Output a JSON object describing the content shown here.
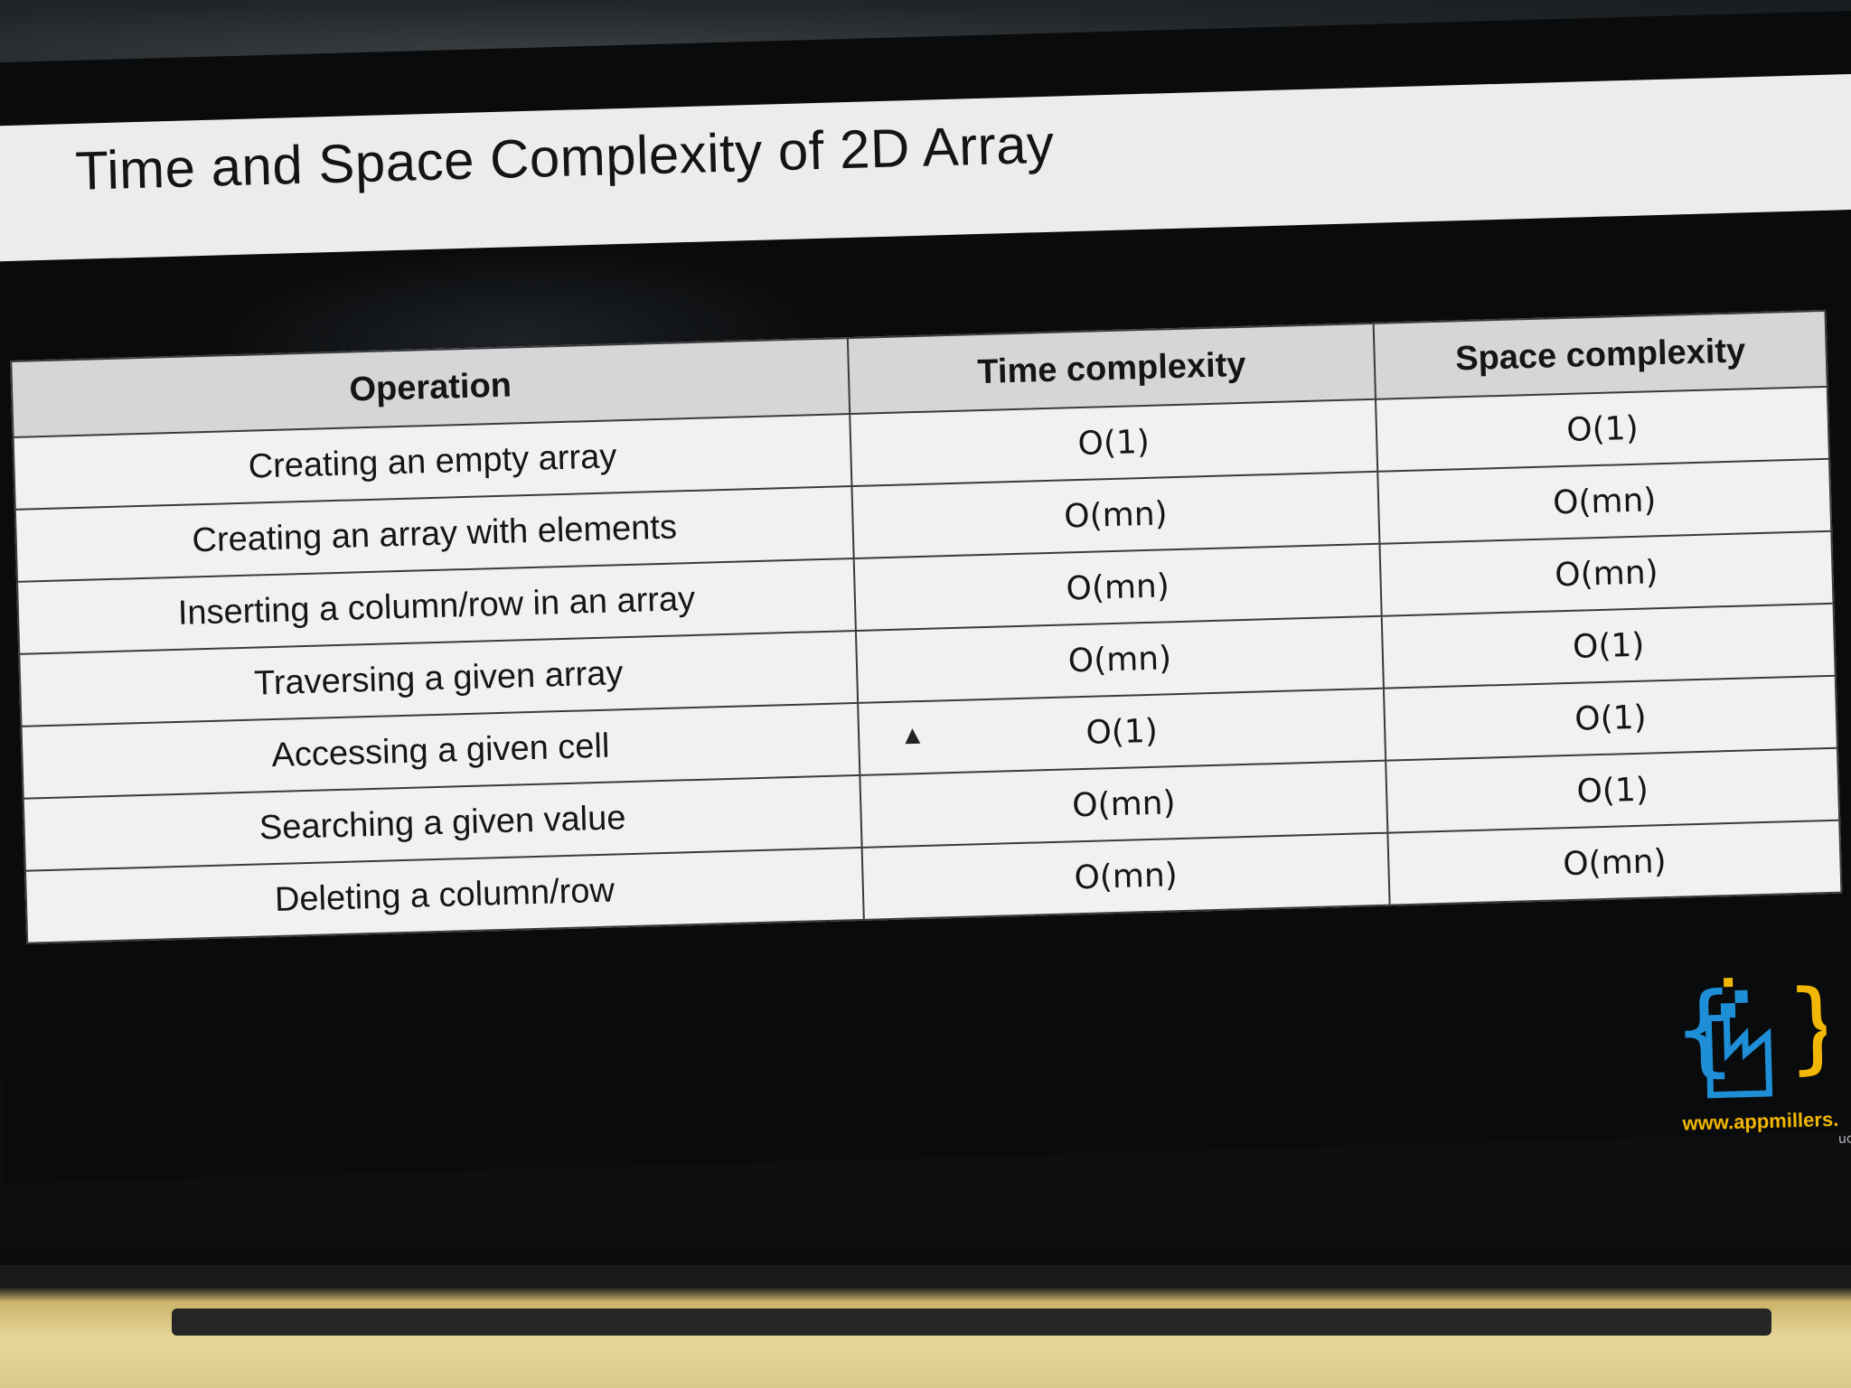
{
  "slide": {
    "title": "Time and Space Complexity of 2D Array"
  },
  "table": {
    "headers": [
      "Operation",
      "Time complexity",
      "Space complexity"
    ],
    "rows": [
      {
        "operation": "Creating an empty array",
        "time": "O(1)",
        "space": "O(1)"
      },
      {
        "operation": "Creating an array with elements",
        "time": "O(mn)",
        "space": "O(mn)"
      },
      {
        "operation": "Inserting a column/row in an array",
        "time": "O(mn)",
        "space": "O(mn)"
      },
      {
        "operation": "Traversing a given array",
        "time": "O(mn)",
        "space": "O(1)"
      },
      {
        "operation": "Accessing a given cell",
        "time": "O(1)",
        "space": "O(1)"
      },
      {
        "operation": "Searching a given value",
        "time": "O(mn)",
        "space": "O(1)"
      },
      {
        "operation": "Deleting a column/row",
        "time": "O(mn)",
        "space": "O(mn)"
      }
    ]
  },
  "brand": {
    "url": "www.appmillers.",
    "suffix": "uc",
    "logo_icon": "appmillers-logo-icon",
    "colors": {
      "blue": "#1e8fd6",
      "yellow": "#f2b705"
    }
  },
  "cursor_icon": "mouse-pointer-icon"
}
